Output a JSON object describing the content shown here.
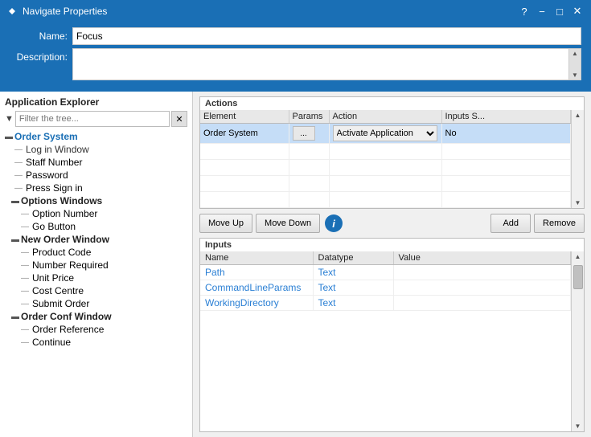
{
  "titleBar": {
    "title": "Navigate Properties",
    "helpBtn": "?",
    "minimizeBtn": "−",
    "restoreBtn": "□",
    "closeBtn": "✕"
  },
  "header": {
    "nameLabel": "Name:",
    "nameValue": "Focus",
    "descLabel": "Description:",
    "descValue": ""
  },
  "leftPanel": {
    "sectionTitle": "Application Explorer",
    "filterPlaceholder": "Filter the tree...",
    "clearBtn": "✕",
    "treeItems": [
      {
        "id": "root",
        "label": "Order System",
        "type": "root",
        "level": 0
      },
      {
        "id": "loginwindow",
        "label": "Log in Window",
        "type": "leaf",
        "level": 1
      },
      {
        "id": "staffnumber",
        "label": "Staff Number",
        "type": "leaf",
        "level": 1
      },
      {
        "id": "password",
        "label": "Password",
        "type": "leaf",
        "level": 1
      },
      {
        "id": "presssignin",
        "label": "Press Sign in",
        "type": "leaf",
        "level": 1
      },
      {
        "id": "optwindows",
        "label": "Options Windows",
        "type": "group",
        "level": 1
      },
      {
        "id": "optionnumber",
        "label": "Option Number",
        "type": "leaf",
        "level": 2
      },
      {
        "id": "gobutton",
        "label": "Go Button",
        "type": "leaf",
        "level": 2
      },
      {
        "id": "neworderwindow",
        "label": "New Order Window",
        "type": "group",
        "level": 1
      },
      {
        "id": "productcode",
        "label": "Product Code",
        "type": "leaf",
        "level": 2
      },
      {
        "id": "numberrequired",
        "label": "Number Required",
        "type": "leaf",
        "level": 2
      },
      {
        "id": "unitprice",
        "label": "Unit Price",
        "type": "leaf",
        "level": 2
      },
      {
        "id": "costcentre",
        "label": "Cost Centre",
        "type": "leaf",
        "level": 2
      },
      {
        "id": "submitorder",
        "label": "Submit Order",
        "type": "leaf",
        "level": 2
      },
      {
        "id": "orderconfwindow",
        "label": "Order Conf Window",
        "type": "group",
        "level": 1
      },
      {
        "id": "orderref",
        "label": "Order Reference",
        "type": "leaf",
        "level": 2
      },
      {
        "id": "continue",
        "label": "Continue",
        "type": "leaf",
        "level": 2
      }
    ]
  },
  "rightPanel": {
    "actionsLabel": "Actions",
    "actionsColumns": [
      {
        "id": "element",
        "label": "Element"
      },
      {
        "id": "params",
        "label": "Params"
      },
      {
        "id": "action",
        "label": "Action"
      },
      {
        "id": "inputss",
        "label": "Inputs S..."
      }
    ],
    "actionsRows": [
      {
        "element": "Order System",
        "params": "...",
        "action": "Activate Application",
        "inputsS": "No",
        "selected": true
      }
    ],
    "moveUpBtn": "Move Up",
    "moveDownBtn": "Move Down",
    "infoIcon": "i",
    "addBtn": "Add",
    "removeBtn": "Remove",
    "inputsLabel": "Inputs",
    "inputsColumns": [
      {
        "id": "name",
        "label": "Name"
      },
      {
        "id": "datatype",
        "label": "Datatype"
      },
      {
        "id": "value",
        "label": "Value"
      }
    ],
    "inputsRows": [
      {
        "name": "Path",
        "datatype": "Text",
        "value": ""
      },
      {
        "name": "CommandLineParams",
        "datatype": "Text",
        "value": ""
      },
      {
        "name": "WorkingDirectory",
        "datatype": "Text",
        "value": ""
      }
    ]
  }
}
